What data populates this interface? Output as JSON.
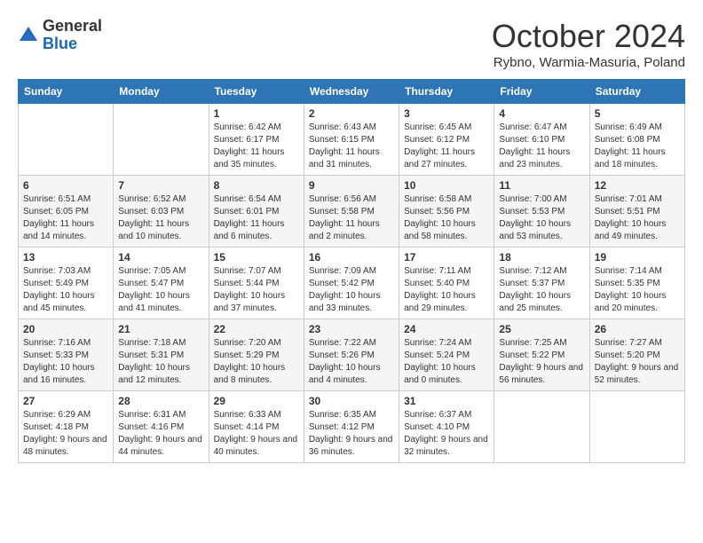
{
  "header": {
    "logo_general": "General",
    "logo_blue": "Blue",
    "month_title": "October 2024",
    "location": "Rybno, Warmia-Masuria, Poland"
  },
  "weekdays": [
    "Sunday",
    "Monday",
    "Tuesday",
    "Wednesday",
    "Thursday",
    "Friday",
    "Saturday"
  ],
  "weeks": [
    [
      {
        "day": "",
        "info": ""
      },
      {
        "day": "",
        "info": ""
      },
      {
        "day": "1",
        "info": "Sunrise: 6:42 AM\nSunset: 6:17 PM\nDaylight: 11 hours and 35 minutes."
      },
      {
        "day": "2",
        "info": "Sunrise: 6:43 AM\nSunset: 6:15 PM\nDaylight: 11 hours and 31 minutes."
      },
      {
        "day": "3",
        "info": "Sunrise: 6:45 AM\nSunset: 6:12 PM\nDaylight: 11 hours and 27 minutes."
      },
      {
        "day": "4",
        "info": "Sunrise: 6:47 AM\nSunset: 6:10 PM\nDaylight: 11 hours and 23 minutes."
      },
      {
        "day": "5",
        "info": "Sunrise: 6:49 AM\nSunset: 6:08 PM\nDaylight: 11 hours and 18 minutes."
      }
    ],
    [
      {
        "day": "6",
        "info": "Sunrise: 6:51 AM\nSunset: 6:05 PM\nDaylight: 11 hours and 14 minutes."
      },
      {
        "day": "7",
        "info": "Sunrise: 6:52 AM\nSunset: 6:03 PM\nDaylight: 11 hours and 10 minutes."
      },
      {
        "day": "8",
        "info": "Sunrise: 6:54 AM\nSunset: 6:01 PM\nDaylight: 11 hours and 6 minutes."
      },
      {
        "day": "9",
        "info": "Sunrise: 6:56 AM\nSunset: 5:58 PM\nDaylight: 11 hours and 2 minutes."
      },
      {
        "day": "10",
        "info": "Sunrise: 6:58 AM\nSunset: 5:56 PM\nDaylight: 10 hours and 58 minutes."
      },
      {
        "day": "11",
        "info": "Sunrise: 7:00 AM\nSunset: 5:53 PM\nDaylight: 10 hours and 53 minutes."
      },
      {
        "day": "12",
        "info": "Sunrise: 7:01 AM\nSunset: 5:51 PM\nDaylight: 10 hours and 49 minutes."
      }
    ],
    [
      {
        "day": "13",
        "info": "Sunrise: 7:03 AM\nSunset: 5:49 PM\nDaylight: 10 hours and 45 minutes."
      },
      {
        "day": "14",
        "info": "Sunrise: 7:05 AM\nSunset: 5:47 PM\nDaylight: 10 hours and 41 minutes."
      },
      {
        "day": "15",
        "info": "Sunrise: 7:07 AM\nSunset: 5:44 PM\nDaylight: 10 hours and 37 minutes."
      },
      {
        "day": "16",
        "info": "Sunrise: 7:09 AM\nSunset: 5:42 PM\nDaylight: 10 hours and 33 minutes."
      },
      {
        "day": "17",
        "info": "Sunrise: 7:11 AM\nSunset: 5:40 PM\nDaylight: 10 hours and 29 minutes."
      },
      {
        "day": "18",
        "info": "Sunrise: 7:12 AM\nSunset: 5:37 PM\nDaylight: 10 hours and 25 minutes."
      },
      {
        "day": "19",
        "info": "Sunrise: 7:14 AM\nSunset: 5:35 PM\nDaylight: 10 hours and 20 minutes."
      }
    ],
    [
      {
        "day": "20",
        "info": "Sunrise: 7:16 AM\nSunset: 5:33 PM\nDaylight: 10 hours and 16 minutes."
      },
      {
        "day": "21",
        "info": "Sunrise: 7:18 AM\nSunset: 5:31 PM\nDaylight: 10 hours and 12 minutes."
      },
      {
        "day": "22",
        "info": "Sunrise: 7:20 AM\nSunset: 5:29 PM\nDaylight: 10 hours and 8 minutes."
      },
      {
        "day": "23",
        "info": "Sunrise: 7:22 AM\nSunset: 5:26 PM\nDaylight: 10 hours and 4 minutes."
      },
      {
        "day": "24",
        "info": "Sunrise: 7:24 AM\nSunset: 5:24 PM\nDaylight: 10 hours and 0 minutes."
      },
      {
        "day": "25",
        "info": "Sunrise: 7:25 AM\nSunset: 5:22 PM\nDaylight: 9 hours and 56 minutes."
      },
      {
        "day": "26",
        "info": "Sunrise: 7:27 AM\nSunset: 5:20 PM\nDaylight: 9 hours and 52 minutes."
      }
    ],
    [
      {
        "day": "27",
        "info": "Sunrise: 6:29 AM\nSunset: 4:18 PM\nDaylight: 9 hours and 48 minutes."
      },
      {
        "day": "28",
        "info": "Sunrise: 6:31 AM\nSunset: 4:16 PM\nDaylight: 9 hours and 44 minutes."
      },
      {
        "day": "29",
        "info": "Sunrise: 6:33 AM\nSunset: 4:14 PM\nDaylight: 9 hours and 40 minutes."
      },
      {
        "day": "30",
        "info": "Sunrise: 6:35 AM\nSunset: 4:12 PM\nDaylight: 9 hours and 36 minutes."
      },
      {
        "day": "31",
        "info": "Sunrise: 6:37 AM\nSunset: 4:10 PM\nDaylight: 9 hours and 32 minutes."
      },
      {
        "day": "",
        "info": ""
      },
      {
        "day": "",
        "info": ""
      }
    ]
  ]
}
